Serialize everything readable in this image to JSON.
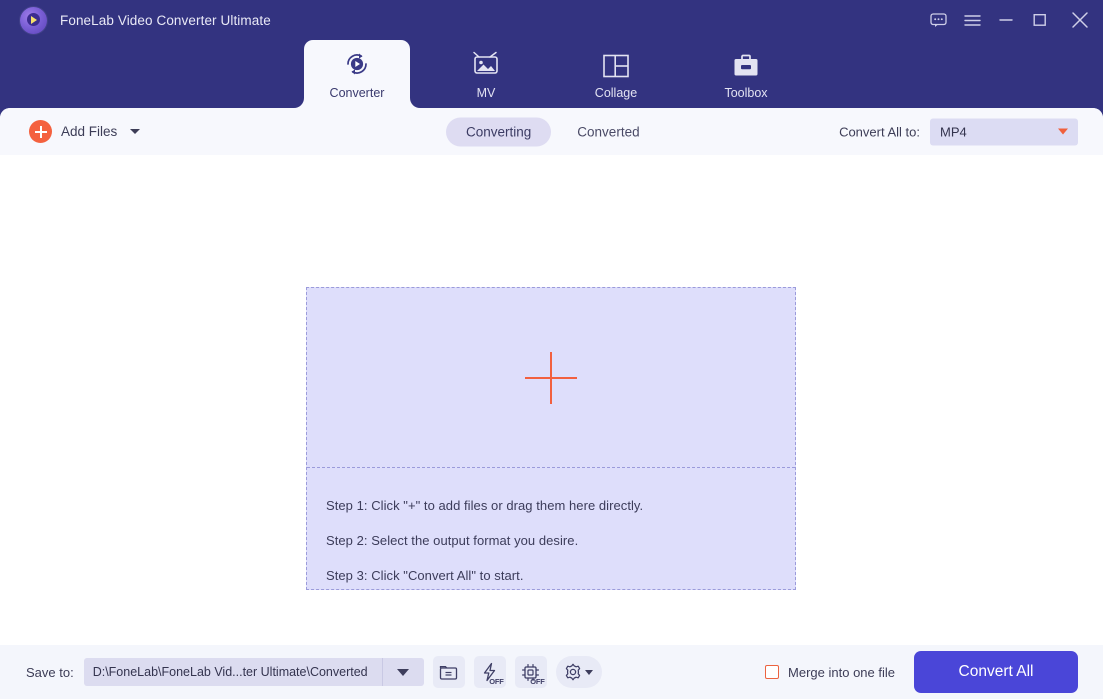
{
  "window": {
    "title": "FoneLab Video Converter Ultimate",
    "logo_icon": "fonelab-play-logo-icon",
    "controls": [
      {
        "name": "feedback-icon",
        "label": "Feedback"
      },
      {
        "name": "menu-icon",
        "label": "Menu"
      },
      {
        "name": "minimize-icon",
        "label": "Minimize"
      },
      {
        "name": "maximize-icon",
        "label": "Maximize"
      },
      {
        "name": "close-icon",
        "label": "Close"
      }
    ]
  },
  "nav": {
    "tabs": [
      {
        "label": "Converter",
        "icon": "converter-refresh-play-icon",
        "active": true
      },
      {
        "label": "MV",
        "icon": "mv-photo-tv-icon",
        "active": false
      },
      {
        "label": "Collage",
        "icon": "collage-grid-icon",
        "active": false
      },
      {
        "label": "Toolbox",
        "icon": "toolbox-briefcase-icon",
        "active": false
      }
    ]
  },
  "toolbar": {
    "add_files_label": "Add Files",
    "add_files_icon": "plus-circle-icon",
    "add_files_caret_icon": "chevron-down-icon",
    "segments": [
      {
        "label": "Converting",
        "active": true
      },
      {
        "label": "Converted",
        "active": false
      }
    ],
    "convert_all_to_label": "Convert All to:",
    "format_value": "MP4",
    "format_caret_icon": "caret-down-icon"
  },
  "dropzone": {
    "plus_icon": "big-plus-icon",
    "steps": [
      "Step 1: Click \"+\" to add files or drag them here directly.",
      "Step 2: Select the output format you desire.",
      "Step 3: Click \"Convert All\" to start."
    ]
  },
  "footer": {
    "save_to_label": "Save to:",
    "save_path": "D:\\FoneLab\\FoneLab Vid...ter Ultimate\\Converted",
    "path_caret_icon": "caret-down-icon",
    "tools": [
      {
        "name": "open-folder-icon",
        "off_tag": ""
      },
      {
        "name": "hardware-acceleration-icon",
        "off_tag": "OFF"
      },
      {
        "name": "gpu-chip-icon",
        "off_tag": "OFF"
      },
      {
        "name": "preferences-gear-icon",
        "off_tag": ""
      }
    ],
    "merge_label": "Merge into one file",
    "merge_checked": false,
    "convert_all_label": "Convert All"
  },
  "colors": {
    "header_bg": "#333380",
    "toolbar_bg": "#f7f8fd",
    "canvas_bg": "#ffffff",
    "dropzone_fill": "#dedefb",
    "dropzone_border": "#9b9bdb",
    "accent_orange": "#f2603f",
    "accent_blue": "#4a46d8",
    "pill_active": "#dedcf2"
  }
}
